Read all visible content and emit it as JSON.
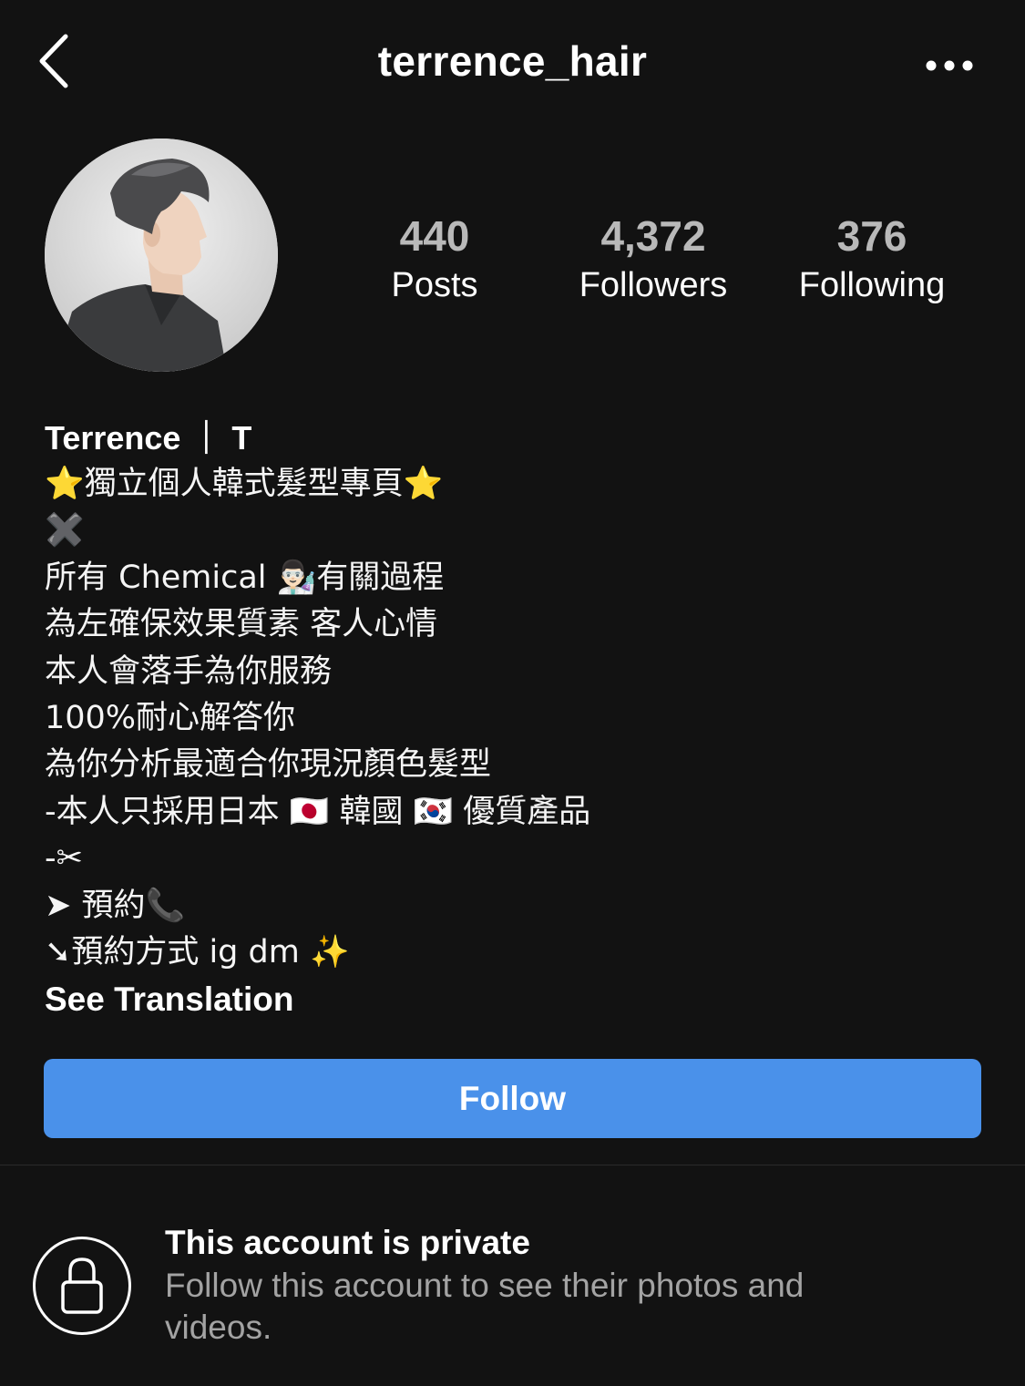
{
  "header": {
    "username": "terrence_hair"
  },
  "profile": {
    "stats": {
      "posts_count": "440",
      "posts_label": "Posts",
      "followers_count": "4,372",
      "followers_label": "Followers",
      "following_count": "376",
      "following_label": "Following"
    },
    "name": "Terrence ｜ T",
    "bio": {
      "line1": "⭐獨立個人韓式髮型專頁⭐",
      "line2": "✖️",
      "line3": "所有 Chemical 👨🏻‍🔬有關過程",
      "line4": "為左確保效果質素 客人心情",
      "line5": "本人會落手為你服務",
      "line6": "100%耐心解答你",
      "line7": "為你分析最適合你現況顏色髮型",
      "line8": "-本人只採用日本 🇯🇵 韓國 🇰🇷 優質產品",
      "line9": "-✂︎",
      "line10": "➤ 預約📞",
      "line11": "➘預約方式 ig dm ✨"
    },
    "see_translation": "See Translation",
    "follow_label": "Follow"
  },
  "private_notice": {
    "title": "This account is private",
    "description": "Follow this account to see their photos and videos."
  },
  "colors": {
    "background": "#121212",
    "accent": "#4a91ea",
    "muted_text": "#a3a3a3"
  },
  "icons": {
    "back": "chevron-left-icon",
    "more": "more-horizontal-icon",
    "lock": "lock-icon"
  }
}
